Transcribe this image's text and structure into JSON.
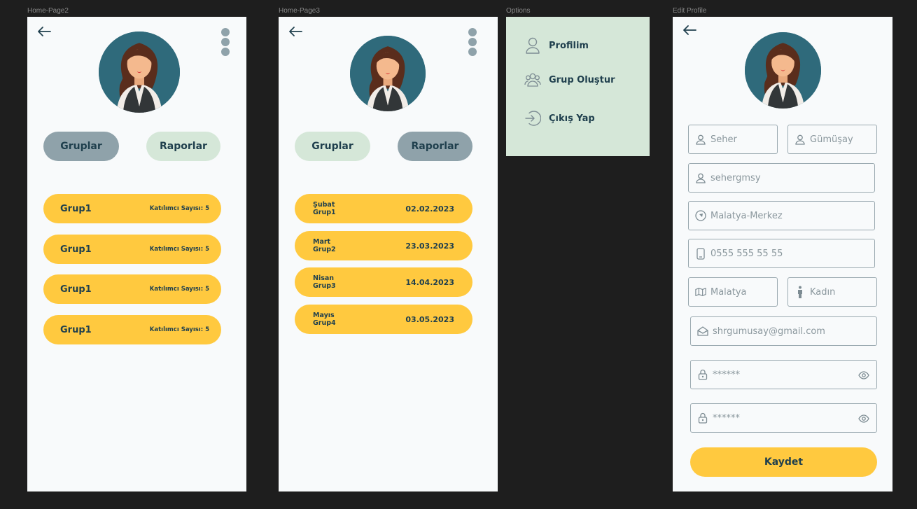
{
  "frames": {
    "home2": {
      "label": "Home-Page2"
    },
    "home3": {
      "label": "Home-Page3"
    },
    "options": {
      "label": "Options"
    },
    "edit": {
      "label": "Edit Profile"
    }
  },
  "icons": {
    "back": "arrow-left-icon",
    "more": "kebab-menu-icon",
    "user": "user-icon",
    "group": "group-icon",
    "logout": "logout-icon",
    "location": "location-icon",
    "phone": "phone-icon",
    "map": "map-icon",
    "gender": "person-icon",
    "email": "email-icon",
    "lock": "lock-icon",
    "eye": "eye-icon"
  },
  "tabs": {
    "groups": "Gruplar",
    "reports": "Raporlar"
  },
  "home2": {
    "groups": [
      {
        "name": "Grup1",
        "meta": "Katılımcı Sayısı: 5"
      },
      {
        "name": "Grup1",
        "meta": "Katılımcı Sayısı: 5"
      },
      {
        "name": "Grup1",
        "meta": "Katılımcı Sayısı: 5"
      },
      {
        "name": "Grup1",
        "meta": "Katılımcı Sayısı: 5"
      }
    ]
  },
  "home3": {
    "reports": [
      {
        "month": "Şubat",
        "group": "Grup1",
        "date": "02.02.2023"
      },
      {
        "month": "Mart",
        "group": "Grup2",
        "date": "23.03.2023"
      },
      {
        "month": "Nisan",
        "group": "Grup3",
        "date": "14.04.2023"
      },
      {
        "month": "Mayıs",
        "group": "Grup4",
        "date": "03.05.2023"
      }
    ]
  },
  "options": {
    "items": [
      {
        "label": "Profilim"
      },
      {
        "label": "Grup Oluştur"
      },
      {
        "label": "Çıkış Yap"
      }
    ]
  },
  "edit": {
    "first_name": "Seher",
    "last_name": "Gümüşay",
    "username": "sehergmsy",
    "location": "Malatya-Merkez",
    "phone": "0555 555 55 55",
    "city": "Malatya",
    "gender": "Kadın",
    "email": "shrgumusay@gmail.com",
    "password": "******",
    "password_confirm": "******",
    "save_label": "Kaydet"
  },
  "colors": {
    "frame_bg": "#f8fafb",
    "canvas_bg": "#1e1e1e",
    "accent_yellow": "#ffc93f",
    "tab_active": "#8fa2aa",
    "tab_inactive": "#d5e7d8",
    "text_dark": "#1f3f4d",
    "options_bg": "#d5e7d8"
  }
}
